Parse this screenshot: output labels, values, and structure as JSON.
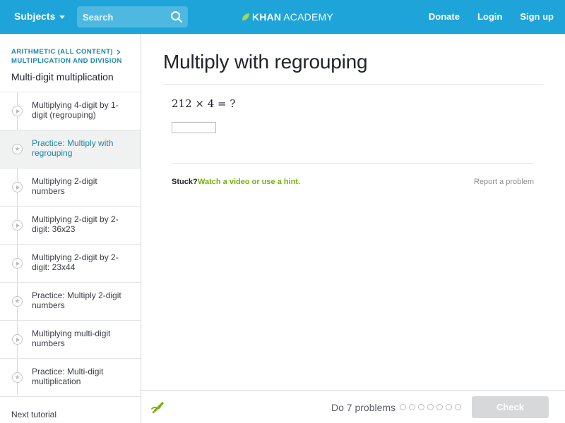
{
  "header": {
    "subjects_label": "Subjects",
    "search_placeholder": "Search",
    "logo_bold": "KHAN",
    "logo_light": "ACADEMY",
    "donate": "Donate",
    "login": "Login",
    "signup": "Sign up",
    "bar_color": "#1ea4d9"
  },
  "sidebar": {
    "breadcrumb_1": "ARITHMETIC (ALL CONTENT)",
    "breadcrumb_2": "MULTIPLICATION AND DIVISION",
    "title": "Multi-digit multiplication",
    "items": [
      {
        "label": "Multiplying 4-digit by 1-digit (regrouping)",
        "icon": "play-icon"
      },
      {
        "label": "Practice: Multiply with regrouping",
        "icon": "star-icon"
      },
      {
        "label": "Multiplying 2-digit numbers",
        "icon": "play-icon"
      },
      {
        "label": "Multiplying 2-digit by 2-digit: 36x23",
        "icon": "play-icon"
      },
      {
        "label": "Multiplying 2-digit by 2-digit: 23x44",
        "icon": "play-icon"
      },
      {
        "label": "Practice: Multiply 2-digit numbers",
        "icon": "star-icon"
      },
      {
        "label": "Multiplying multi-digit numbers",
        "icon": "play-icon"
      },
      {
        "label": "Practice: Multi-digit multiplication",
        "icon": "star-icon"
      }
    ],
    "next_tutorial_label": "Next tutorial"
  },
  "main": {
    "title": "Multiply with regrouping",
    "question": "212 × 4 = ?",
    "stuck_label": "Stuck?",
    "hint_link": "Watch a video or use a hint.",
    "report_link": "Report a problem"
  },
  "footer": {
    "do_problems": "Do 7 problems",
    "check_label": "Check",
    "accent_green": "#71b307"
  }
}
